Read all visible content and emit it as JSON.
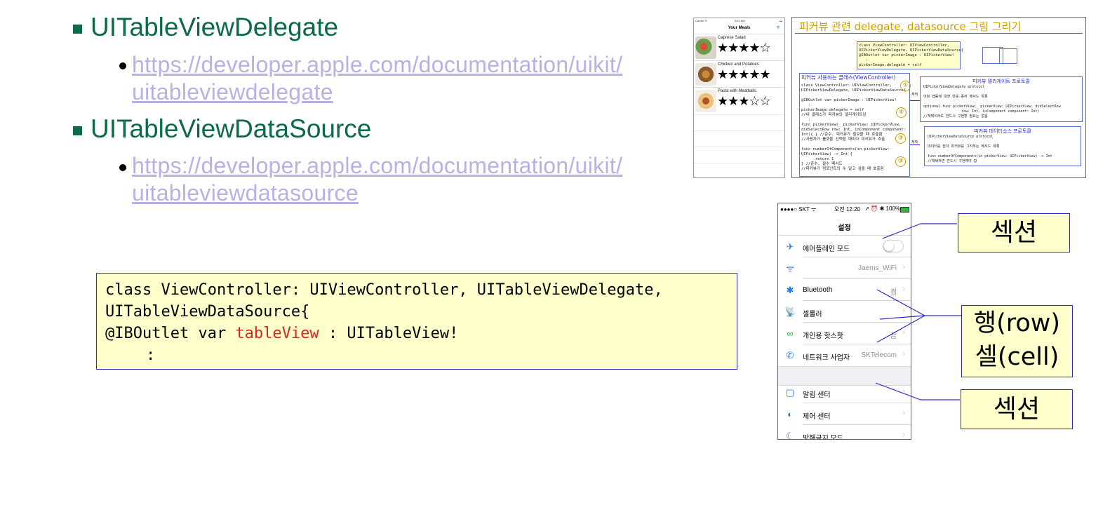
{
  "sections": [
    {
      "heading": "UITableViewDelegate",
      "link_lines": [
        "https://developer.apple.com/documentation/uikit/",
        "uitableviewdelegate"
      ]
    },
    {
      "heading": "UITableViewDataSource",
      "link_lines": [
        "https://developer.apple.com/documentation/uikit/",
        "uitableviewdatasource"
      ]
    }
  ],
  "code": {
    "line1": "class ViewController: UIViewController, UITableViewDelegate,",
    "line2": "UITableViewDataSource{",
    "line3_pre": "@IBOutlet var ",
    "line3_red": "tableView",
    "line3_post": " : UITableView!",
    "line4": ":"
  },
  "meals_screen": {
    "status_left": "Carrier ✈",
    "status_time": "9:41 AM",
    "status_right": "▬",
    "title": "Your Meals",
    "add": "+",
    "items": [
      {
        "name": "Caprese Salad",
        "stars": "★★★★☆"
      },
      {
        "name": "Chicken and Potatoes",
        "stars": "★★★★★"
      },
      {
        "name": "Pasta with Meatballs",
        "stars": "★★★☆☆"
      }
    ]
  },
  "diagram": {
    "title": "피커뷰 관련 delegate, datasource 그림 그리기",
    "top_code": "class ViewController: UIViewController,\nUIPickerViewDelegate, UIPickerViewDataSource{\n@IBOutlet var pickerImage : UIPickerView!\n   :\npickerImage.delegate = self",
    "left_title": "피커뷰 사용하는 클래스(ViewController)",
    "left_code": "class ViewController: UIViewController,\nUIPickerViewDelegate, UIPickerViewDataSource{\n\n@IBOutlet var pickerImage : UIPickerView!\n   :\npickerImage.delegate = self\n//내 클래스가 피커뷰의 델리게이트임\n   :\nfunc pickerView(_ pickerView: UIPickerView,\ndidSelectRow row: Int, inComponent component:\nInt){ } //준수, 피커뷰가 필요할 때 호출함\n//사용자가 룰렛을 선택할 때마다 피커뷰가 호출\n\nfunc numberOfComponents(in pickerView:\nUIPickerView) -> Int {\n      return 1\n} //준수, 필수 메서드\n//피커뷰가 컴포넌트의 수 알고 싶을 때 호출함",
    "delegate_title": "피커뷰 델리게이트 프로토콜",
    "delegate_code": "UIPickerViewDelegate protocol\n\n어떤 행동에 대한 반응 동작 메서드 목록\n\noptional func pickerView(_ pickerView: UIPickerView, didSelectRow\n                  row: Int, inComponent component: Int)\n//재택이라도 반드시 구현할 필요는 없음",
    "datasource_title": "피커뷰 데이터소스 프로토콜",
    "datasource_code": "UIPickerViewDataSource protocol\n\n데이터를 받아 피커뷰를 그려주는 메서드 목록\n\nfunc numberOfComponents(in pickerView: UIPickerView) -> Int\n//채택하면 반드시 구현해야 함",
    "badges": [
      "①",
      "②",
      "③",
      "③"
    ],
    "arrow_label": "채택"
  },
  "settings_screen": {
    "status_left": "●●●●○ SKT ᯤ",
    "status_time": "오전 12:20",
    "status_right": "➚ ⏰ ✱ 100%",
    "title": "설정",
    "rows": [
      {
        "icon": "✈",
        "icon_color": "#1d7cf2",
        "label": "에어플레인 모드",
        "value": "",
        "toggle": true
      },
      {
        "icon": "ᯤ",
        "icon_color": "#1d7cf2",
        "label": "",
        "value": "Jaems_WiFi",
        "toggle": false
      },
      {
        "icon": "✱",
        "icon_color": "#1d7cf2",
        "label": "Bluetooth",
        "value": "켬",
        "toggle": false
      },
      {
        "icon": "📡",
        "icon_color": "#3cb043",
        "label": "셀룰러",
        "value": "",
        "toggle": false
      },
      {
        "icon": "∞",
        "icon_color": "#3cb043",
        "label": "개인용 핫스팟",
        "value": "끔",
        "toggle": false
      },
      {
        "icon": "✆",
        "icon_color": "#3cb043",
        "label": "네트워크 사업자",
        "value": "SKTelecom",
        "toggle": false
      },
      {
        "icon": "▢",
        "icon_color": "#ff3b30",
        "label": "알림 센터",
        "value": "",
        "toggle": false
      },
      {
        "icon": "◐",
        "icon_color": "#8e8e93",
        "label": "제어 센터",
        "value": "",
        "toggle": false
      },
      {
        "icon": "☾",
        "icon_color": "#5856d6",
        "label": "방해금지 모드",
        "value": "",
        "toggle": false
      }
    ]
  },
  "callouts": {
    "section_top": "섹션",
    "row_line1": "행(row)",
    "row_line2": "셀(cell)",
    "section_bottom": "섹션"
  },
  "colors": {
    "heading": "#0b6a4a",
    "link": "#b9b0e6",
    "box_fill": "#ffffcc",
    "box_border": "#2b2bd0",
    "code_red": "#e8201c"
  }
}
